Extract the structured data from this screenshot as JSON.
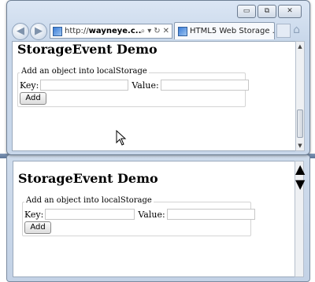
{
  "browser_top": {
    "address": {
      "prefix": "http://",
      "domain": "wayneye.c..."
    },
    "tab_title": "HTML5 Web Storage ...",
    "controls": {
      "minimize": "▭",
      "restore": "⧉",
      "close": "✕"
    },
    "icons": [
      "back-icon",
      "forward-icon",
      "search-icon",
      "dropdown-icon",
      "refresh-icon",
      "stop-icon",
      "home-icon"
    ]
  },
  "page_top": {
    "heading": "StorageEvent Demo",
    "legend": "Add an object into localStorage",
    "key_label": "Key:",
    "value_label": "Value:",
    "add_button": "Add",
    "key_value": "",
    "value_value": ""
  },
  "page_bottom": {
    "heading": "StorageEvent Demo",
    "legend": "Add an object into localStorage",
    "key_label": "Key:",
    "value_label": "Value:",
    "add_button": "Add",
    "key_value": "",
    "value_value": ""
  },
  "colors": {
    "chrome": "#c8d7ea",
    "frame_border": "#6e7f94",
    "page_bg": "#ffffff"
  }
}
